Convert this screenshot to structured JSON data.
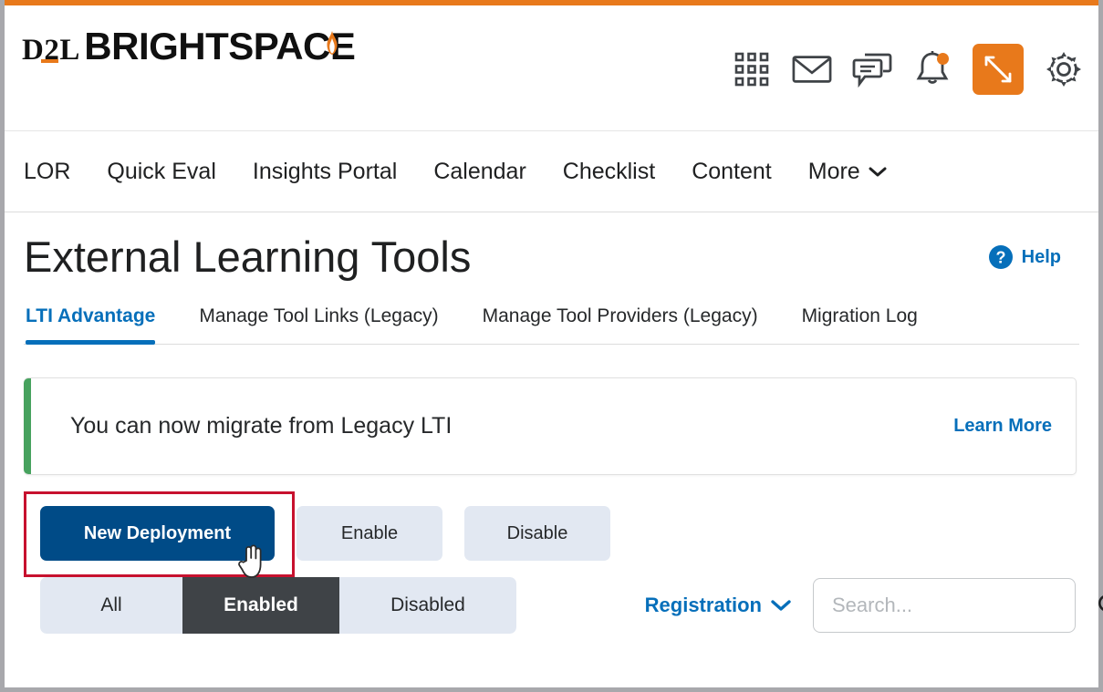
{
  "brand": {
    "logo_top": "D2L",
    "logo_bottom": "BRIGHTSPACE",
    "accent_color": "#e8791b"
  },
  "header": {
    "icons": [
      {
        "name": "waffle-grid-icon",
        "label": "Course Selector"
      },
      {
        "name": "envelope-icon",
        "label": "Email"
      },
      {
        "name": "chat-bubbles-icon",
        "label": "Chat"
      },
      {
        "name": "bell-icon",
        "label": "Notifications",
        "has_badge": true
      },
      {
        "name": "swap-arrows-icon",
        "label": "Switch",
        "highlighted": true
      },
      {
        "name": "gear-icon",
        "label": "Settings"
      }
    ]
  },
  "nav": {
    "items": [
      {
        "label": "LOR"
      },
      {
        "label": "Quick Eval"
      },
      {
        "label": "Insights Portal"
      },
      {
        "label": "Calendar"
      },
      {
        "label": "Checklist"
      },
      {
        "label": "Content"
      },
      {
        "label": "More",
        "has_chevron": true
      }
    ]
  },
  "page": {
    "title": "External Learning Tools",
    "help_label": "Help"
  },
  "tabs": [
    {
      "label": "LTI Advantage",
      "active": true
    },
    {
      "label": "Manage Tool Links (Legacy)",
      "active": false
    },
    {
      "label": "Manage Tool Providers (Legacy)",
      "active": false
    },
    {
      "label": "Migration Log",
      "active": false
    }
  ],
  "banner": {
    "message": "You can now migrate from Legacy LTI",
    "link_label": "Learn More",
    "accent_color": "#47a25e"
  },
  "actions": {
    "new_deployment_label": "New Deployment",
    "enable_label": "Enable",
    "disable_label": "Disable",
    "primary_color": "#004b87",
    "highlight_color": "#c7112e"
  },
  "filters": {
    "segments": [
      {
        "label": "All",
        "selected": false
      },
      {
        "label": "Enabled",
        "selected": true
      },
      {
        "label": "Disabled",
        "selected": false
      }
    ],
    "registration_label": "Registration",
    "search": {
      "placeholder": "Search...",
      "value": ""
    }
  }
}
